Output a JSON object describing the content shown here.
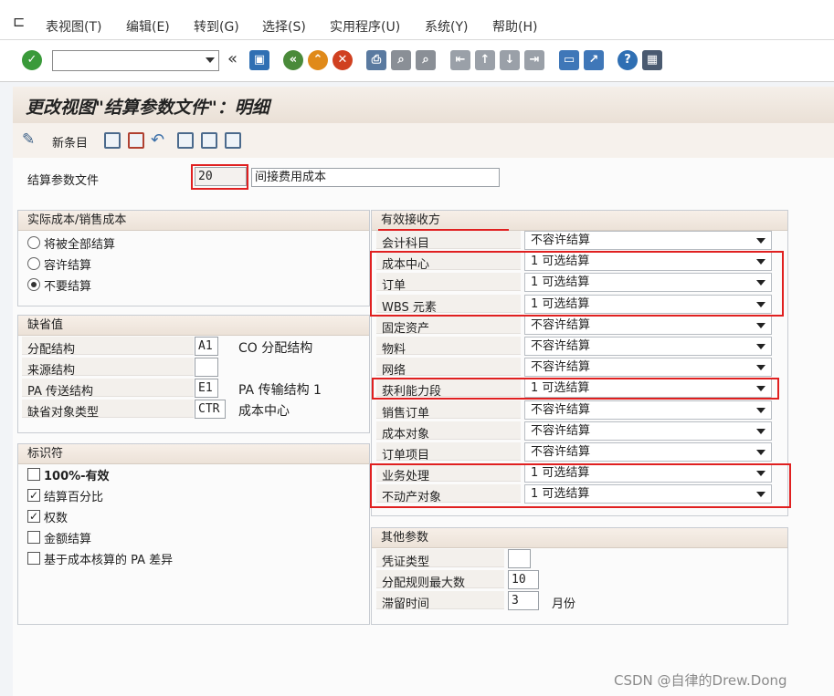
{
  "menubar": {
    "items": [
      "表视图(T)",
      "编辑(E)",
      "转到(G)",
      "选择(S)",
      "实用程序(U)",
      "系统(Y)",
      "帮助(H)"
    ]
  },
  "toolbar": {
    "command_value": "",
    "icons": [
      "enter-icon",
      "back-icon",
      "save-icon",
      "nav-back-icon",
      "exit-icon",
      "cancel-icon",
      "print-icon",
      "find-icon",
      "find-next-icon",
      "first-page-icon",
      "prev-page-icon",
      "next-page-icon",
      "last-page-icon",
      "new-session-icon",
      "shortcut-icon",
      "help-icon",
      "customize-icon"
    ]
  },
  "title": "更改视图\"结算参数文件\"：明细",
  "appbar": {
    "new_entries_label": "新条目"
  },
  "header": {
    "profile_label": "结算参数文件",
    "profile_value": "20",
    "profile_text": "间接费用成本"
  },
  "actual_costs": {
    "title": "实际成本/销售成本",
    "options": [
      "将被全部结算",
      "容许结算",
      "不要结算"
    ],
    "selected_index": 2
  },
  "defaults": {
    "title": "缺省值",
    "rows": [
      {
        "label": "分配结构",
        "value": "A1",
        "text": "CO 分配结构"
      },
      {
        "label": "来源结构",
        "value": "",
        "text": ""
      },
      {
        "label": "PA 传送结构",
        "value": "E1",
        "text": "PA 传输结构 1"
      },
      {
        "label": "缺省对象类型",
        "value": "CTR",
        "text": "成本中心"
      }
    ]
  },
  "indicators": {
    "title": "标识符",
    "items": [
      {
        "label": "100%-有效",
        "checked": false
      },
      {
        "label": "结算百分比",
        "checked": true
      },
      {
        "label": "权数",
        "checked": true
      },
      {
        "label": "金额结算",
        "checked": false
      },
      {
        "label": "基于成本核算的 PA 差异",
        "checked": false
      }
    ]
  },
  "receivers": {
    "title": "有效接收方",
    "rows": [
      {
        "label": "会计科目",
        "value": "不容许结算"
      },
      {
        "label": "成本中心",
        "value": "1 可选结算"
      },
      {
        "label": "订单",
        "value": "1 可选结算"
      },
      {
        "label": "WBS 元素",
        "value": "1 可选结算"
      },
      {
        "label": "固定资产",
        "value": "不容许结算"
      },
      {
        "label": "物料",
        "value": "不容许结算"
      },
      {
        "label": "网络",
        "value": "不容许结算"
      },
      {
        "label": "获利能力段",
        "value": "1 可选结算"
      },
      {
        "label": "销售订单",
        "value": "不容许结算"
      },
      {
        "label": "成本对象",
        "value": "不容许结算"
      },
      {
        "label": "订单项目",
        "value": "不容许结算"
      },
      {
        "label": "业务处理",
        "value": "1 可选结算"
      },
      {
        "label": "不动产对象",
        "value": "1 可选结算"
      }
    ]
  },
  "other_params": {
    "title": "其他参数",
    "rows": [
      {
        "label": "凭证类型",
        "value": "",
        "unit": ""
      },
      {
        "label": "分配规则最大数",
        "value": "10",
        "unit": ""
      },
      {
        "label": "滞留时间",
        "value": "3",
        "unit": "月份"
      }
    ]
  },
  "watermark": "CSDN @自律的Drew.Dong",
  "colors": {
    "highlight": "#e02020",
    "title_bg": "#eae0d6",
    "group_header": "#ece2d8"
  }
}
